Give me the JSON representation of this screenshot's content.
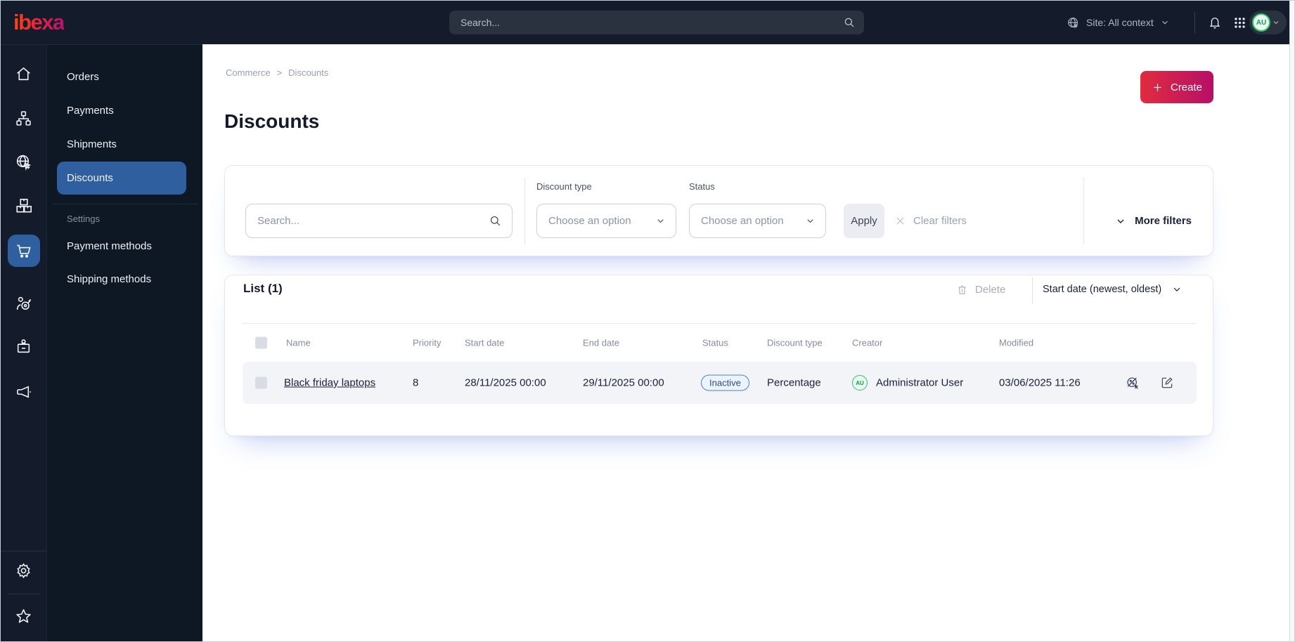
{
  "topbar": {
    "logo": "ibexa",
    "search_placeholder": "Search...",
    "site_context": "Site: All context",
    "avatar_initials": "AU"
  },
  "colors": {
    "brand_gradient_start": "#ff4713",
    "brand_gradient_end": "#b4156e",
    "create_gradient": [
      "#e02c3f",
      "#b70f68"
    ],
    "nav_selected_blue": "#2f5f9f",
    "dark_bg": "#141c2b",
    "status_inactive_border": "#4c80cf",
    "status_inactive_text": "#2a4c80",
    "avatar_green": "#2fc168"
  },
  "nav_rail": {
    "items": [
      {
        "icon": "home-icon"
      },
      {
        "icon": "sitemap-icon"
      },
      {
        "icon": "site-globe-icon"
      },
      {
        "icon": "products-icon"
      },
      {
        "icon": "commerce-cart-icon",
        "selected": true
      },
      {
        "icon": "personalization-icon"
      },
      {
        "icon": "corporate-badge-icon"
      },
      {
        "icon": "marketing-megaphone-icon"
      },
      {
        "icon": "settings-gear-icon"
      },
      {
        "icon": "bookmarks-star-icon"
      }
    ]
  },
  "menu": {
    "items": [
      {
        "label": "Orders"
      },
      {
        "label": "Payments"
      },
      {
        "label": "Shipments"
      },
      {
        "label": "Discounts",
        "selected": true
      }
    ],
    "section_label": "Settings",
    "section_items": [
      {
        "label": "Payment methods"
      },
      {
        "label": "Shipping methods"
      }
    ]
  },
  "breadcrumb": {
    "items": [
      "Commerce",
      "Discounts"
    ],
    "separator": ">"
  },
  "page": {
    "title": "Discounts",
    "create_label": "Create"
  },
  "filters": {
    "search_placeholder": "Search...",
    "discount_type_label": "Discount type",
    "discount_type_value": "Choose an option",
    "status_label": "Status",
    "status_value": "Choose an option",
    "apply_label": "Apply",
    "clear_label": "Clear filters",
    "more_filters_label": "More filters"
  },
  "list": {
    "title": "List (1)",
    "delete_label": "Delete",
    "sort_label": "Start date (newest, oldest)",
    "columns": [
      "Name",
      "Priority",
      "Start date",
      "End date",
      "Status",
      "Discount type",
      "Creator",
      "Modified"
    ],
    "rows": [
      {
        "name": "Black friday laptops",
        "priority": "8",
        "start_date": "28/11/2025 00:00",
        "end_date": "29/11/2025 00:00",
        "status": "Inactive",
        "discount_type": "Percentage",
        "creator": "Administrator User",
        "creator_initials": "AU",
        "modified": "03/06/2025 11:26"
      }
    ]
  }
}
